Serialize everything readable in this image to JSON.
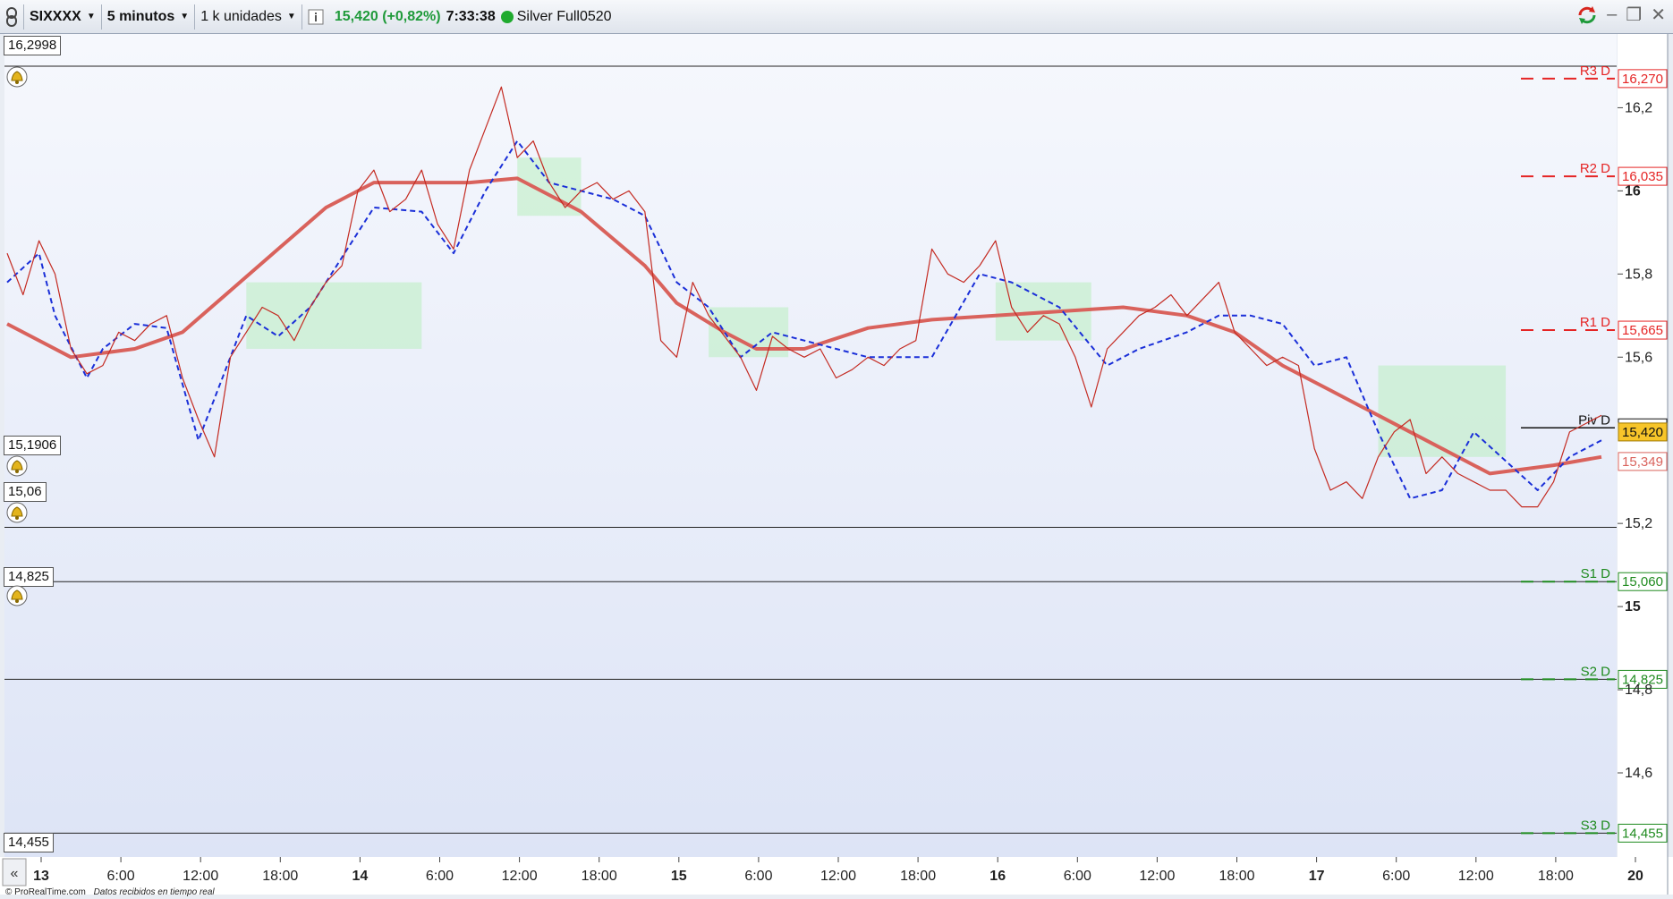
{
  "toolbar": {
    "symbol": "SIXXXX",
    "timeframe": "5 minutos",
    "units": "1 k unidades",
    "info_icon": "info-icon",
    "last_price": "15,420 (+0,82%)",
    "time": "7:33:38",
    "account": "Silver Full0520"
  },
  "window_controls": {
    "refresh": "refresh-icon",
    "minimize": "–",
    "restore": "❐",
    "close": "✕"
  },
  "level_boxes": [
    {
      "label": "16,2998"
    },
    {
      "label": "15,1906"
    },
    {
      "label": "15,06"
    },
    {
      "label": "14,825"
    },
    {
      "label": "14,455"
    }
  ],
  "watermark": {
    "brand": "© ProRealTime.com",
    "status": "Datos recibidos en tiempo real"
  },
  "colors": {
    "bg": "#e9edf3",
    "ma_red": "#d9625c",
    "dashed_blue": "#1a2fd8",
    "cloud_green": "#b9efbf",
    "cloud_cyan": "#c4f1f6",
    "resistance": "#e52424",
    "support": "#1e8a1e"
  },
  "chart_data": {
    "type": "line",
    "x_ticks": [
      "13",
      "6:00",
      "12:00",
      "18:00",
      "14",
      "6:00",
      "12:00",
      "18:00",
      "15",
      "6:00",
      "12:00",
      "18:00",
      "16",
      "6:00",
      "12:00",
      "18:00",
      "17",
      "6:00",
      "12:00",
      "18:00",
      "20"
    ],
    "x_major_ticks": [
      "13",
      "14",
      "15",
      "16",
      "17",
      "20"
    ],
    "y_ticks": [
      "16,2",
      "16",
      "15,8",
      "15,6",
      "15,2",
      "15",
      "14,8",
      "14,6"
    ],
    "y_major": [
      "16",
      "15"
    ],
    "ylim": [
      14.43,
      16.33
    ],
    "pivot_levels": [
      {
        "name": "R3 D",
        "value": 16.27,
        "label": "16,270",
        "kind": "res"
      },
      {
        "name": "R2 D",
        "value": 16.035,
        "label": "16,035",
        "kind": "res"
      },
      {
        "name": "R1 D",
        "value": 15.665,
        "label": "15,665",
        "kind": "res"
      },
      {
        "name": "Piv D",
        "value": 15.43,
        "label": "15,430",
        "kind": "piv"
      },
      {
        "name": "S1 D",
        "value": 15.06,
        "label": "15,060",
        "kind": "sup"
      },
      {
        "name": "S2 D",
        "value": 14.825,
        "label": "14,825",
        "kind": "sup"
      },
      {
        "name": "S3 D",
        "value": 14.455,
        "label": "14,455",
        "kind": "sup"
      }
    ],
    "current_price": {
      "value": 15.42,
      "label": "15,420"
    },
    "ma_value": {
      "value": 15.349,
      "label": "15,349"
    },
    "alert_levels": [
      16.2998,
      15.1906,
      15.06,
      14.825,
      14.455
    ],
    "series": [
      {
        "kind": "ma_red",
        "x": [
          0.0,
          0.4,
          0.8,
          1.1,
          1.4,
          1.7,
          2.0,
          2.3,
          2.6,
          2.9,
          3.2,
          3.6,
          4.0,
          4.2,
          4.5,
          4.7,
          5.0,
          5.4,
          5.8,
          6.2,
          6.6,
          7.0,
          7.4,
          7.7,
          8.0,
          8.3,
          8.6,
          8.9,
          9.3,
          9.7,
          10.0
        ],
        "y": [
          15.68,
          15.6,
          15.62,
          15.66,
          15.76,
          15.86,
          15.96,
          16.02,
          16.02,
          16.02,
          16.03,
          15.95,
          15.82,
          15.73,
          15.66,
          15.62,
          15.62,
          15.67,
          15.69,
          15.7,
          15.71,
          15.72,
          15.7,
          15.66,
          15.58,
          15.52,
          15.46,
          15.4,
          15.32,
          15.34,
          15.36
        ]
      },
      {
        "kind": "dashed_blue",
        "x": [
          0.0,
          0.2,
          0.3,
          0.5,
          0.6,
          0.8,
          1.0,
          1.2,
          1.4,
          1.5,
          1.7,
          1.9,
          2.0,
          2.3,
          2.6,
          2.8,
          3.0,
          3.2,
          3.4,
          3.6,
          3.8,
          4.0,
          4.2,
          4.4,
          4.6,
          4.8,
          5.0,
          5.2,
          5.4,
          5.6,
          5.8,
          6.1,
          6.3,
          6.6,
          6.9,
          7.1,
          7.4,
          7.6,
          7.8,
          8.0,
          8.2,
          8.4,
          8.6,
          8.8,
          9.0,
          9.2,
          9.4,
          9.6,
          9.8,
          10.0
        ],
        "y": [
          15.78,
          15.85,
          15.7,
          15.55,
          15.62,
          15.68,
          15.67,
          15.4,
          15.6,
          15.7,
          15.65,
          15.72,
          15.78,
          15.96,
          15.95,
          15.85,
          16.0,
          16.12,
          16.02,
          16.0,
          15.98,
          15.94,
          15.78,
          15.72,
          15.6,
          15.66,
          15.64,
          15.62,
          15.6,
          15.6,
          15.6,
          15.8,
          15.78,
          15.72,
          15.58,
          15.62,
          15.66,
          15.7,
          15.7,
          15.68,
          15.58,
          15.6,
          15.42,
          15.26,
          15.28,
          15.42,
          15.35,
          15.28,
          15.36,
          15.4
        ]
      },
      {
        "kind": "price_red",
        "x": [
          0.0,
          0.1,
          0.2,
          0.3,
          0.4,
          0.5,
          0.6,
          0.7,
          0.8,
          0.9,
          1.0,
          1.1,
          1.2,
          1.3,
          1.4,
          1.5,
          1.6,
          1.7,
          1.8,
          1.9,
          2.0,
          2.1,
          2.2,
          2.3,
          2.4,
          2.5,
          2.6,
          2.7,
          2.8,
          2.9,
          3.0,
          3.1,
          3.2,
          3.3,
          3.4,
          3.5,
          3.6,
          3.7,
          3.8,
          3.9,
          4.0,
          4.1,
          4.2,
          4.3,
          4.4,
          4.5,
          4.6,
          4.7,
          4.8,
          4.9,
          5.0,
          5.1,
          5.2,
          5.3,
          5.4,
          5.5,
          5.6,
          5.7,
          5.8,
          5.9,
          6.0,
          6.1,
          6.2,
          6.3,
          6.4,
          6.5,
          6.6,
          6.7,
          6.8,
          6.9,
          7.0,
          7.1,
          7.2,
          7.3,
          7.4,
          7.5,
          7.6,
          7.7,
          7.8,
          7.9,
          8.0,
          8.1,
          8.2,
          8.3,
          8.4,
          8.5,
          8.6,
          8.7,
          8.8,
          8.9,
          9.0,
          9.1,
          9.2,
          9.3,
          9.4,
          9.5,
          9.6,
          9.7,
          9.8,
          9.9,
          10.0
        ],
        "y": [
          15.85,
          15.75,
          15.88,
          15.8,
          15.62,
          15.56,
          15.58,
          15.66,
          15.64,
          15.68,
          15.7,
          15.55,
          15.45,
          15.36,
          15.6,
          15.66,
          15.72,
          15.7,
          15.64,
          15.72,
          15.78,
          15.82,
          16.0,
          16.05,
          15.95,
          15.98,
          16.05,
          15.92,
          15.86,
          16.05,
          16.15,
          16.25,
          16.08,
          16.12,
          16.02,
          15.96,
          16.0,
          16.02,
          15.98,
          16.0,
          15.95,
          15.64,
          15.6,
          15.78,
          15.7,
          15.65,
          15.6,
          15.52,
          15.65,
          15.62,
          15.6,
          15.62,
          15.55,
          15.57,
          15.6,
          15.58,
          15.62,
          15.64,
          15.86,
          15.8,
          15.78,
          15.82,
          15.88,
          15.72,
          15.66,
          15.7,
          15.68,
          15.6,
          15.48,
          15.62,
          15.66,
          15.7,
          15.72,
          15.75,
          15.7,
          15.74,
          15.78,
          15.66,
          15.62,
          15.58,
          15.6,
          15.58,
          15.38,
          15.28,
          15.3,
          15.26,
          15.36,
          15.42,
          15.45,
          15.32,
          15.36,
          15.32,
          15.3,
          15.28,
          15.28,
          15.24,
          15.24,
          15.3,
          15.42,
          15.44,
          15.46
        ]
      }
    ]
  }
}
